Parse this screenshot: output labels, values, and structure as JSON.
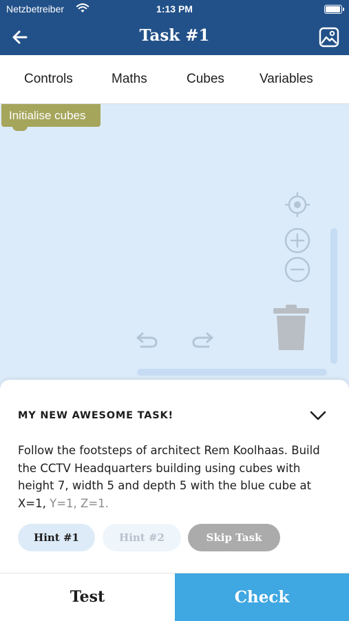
{
  "status_bar": {
    "carrier": "Netzbetreiber",
    "time": "1:13 PM",
    "battery_level": 0.95
  },
  "nav_bar": {
    "title": "Task #1",
    "icons": [
      "back-arrow-icon",
      "image-icon"
    ]
  },
  "tabs": [
    {
      "label": "Controls"
    },
    {
      "label": "Maths"
    },
    {
      "label": "Cubes"
    },
    {
      "label": "Variables"
    }
  ],
  "workspace": {
    "block_label": "Initialise cubes",
    "block_color": "#a5a55c",
    "background_color": "#dcebfa",
    "icons": [
      "recenter-icon",
      "zoom-in-icon",
      "zoom-out-icon",
      "undo-icon",
      "redo-icon",
      "trash-icon"
    ]
  },
  "task": {
    "title": "MY NEW AWESOME TASK!",
    "description_main": "Follow the footsteps of architect Rem Koolhaas. Build the CCTV Headquarters building using cubes with height 7, width 5 and depth 5 with the blue cube at X=1,",
    "description_faded": "Y=1, Z=1.",
    "hints": [
      {
        "label": "Hint #1"
      },
      {
        "label": "Hint #2"
      }
    ],
    "skip_label": "Skip Task"
  },
  "bottom": {
    "test_label": "Test",
    "check_label": "Check",
    "check_color": "#3fa7e1"
  },
  "theme": {
    "header_color": "#225189"
  }
}
